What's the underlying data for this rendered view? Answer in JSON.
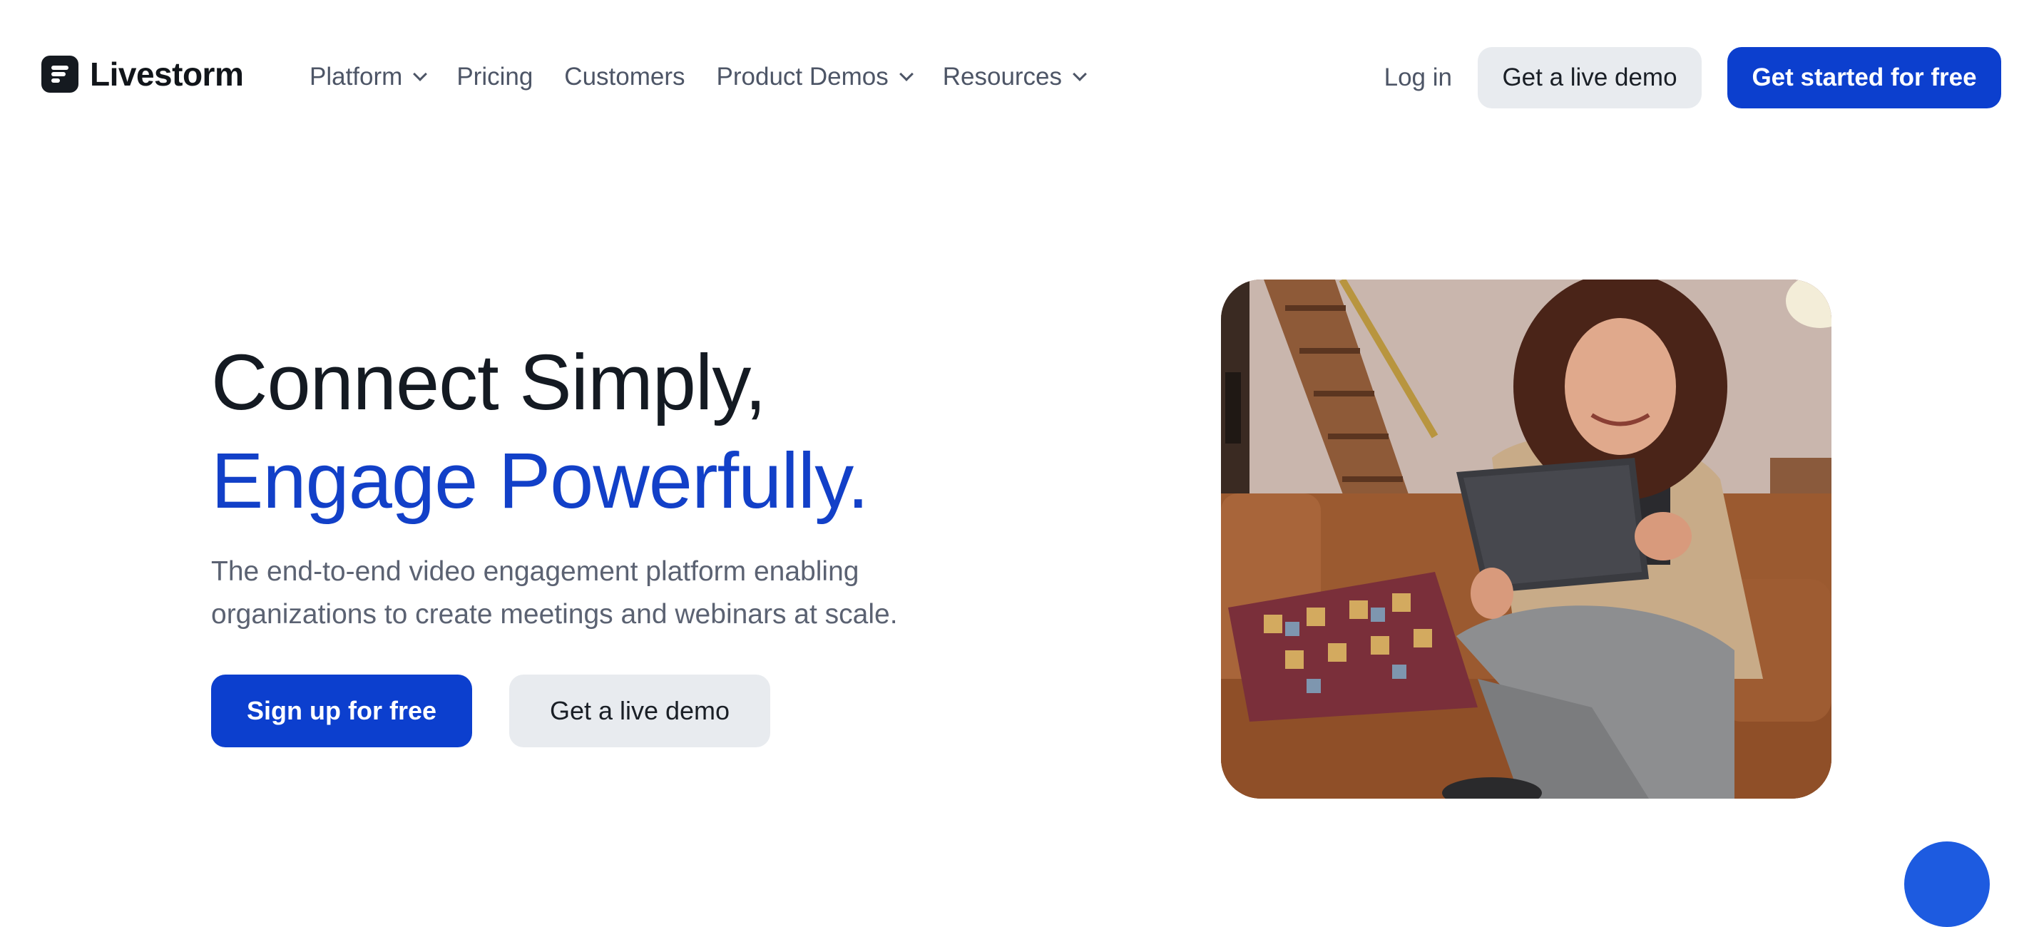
{
  "brand": {
    "name": "Livestorm",
    "primary_color": "#0c3fce",
    "accent_text_color": "#1240c8"
  },
  "nav": {
    "items": [
      {
        "label": "Platform",
        "has_dropdown": true
      },
      {
        "label": "Pricing",
        "has_dropdown": false
      },
      {
        "label": "Customers",
        "has_dropdown": false
      },
      {
        "label": "Product Demos",
        "has_dropdown": true
      },
      {
        "label": "Resources",
        "has_dropdown": true
      }
    ],
    "login_label": "Log in",
    "demo_label": "Get a live demo",
    "start_label": "Get started for free"
  },
  "hero": {
    "title_line1": "Connect Simply,",
    "title_line2": "Engage Powerfully.",
    "subtitle": "The end-to-end video engagement platform enabling organizations to create meetings and webinars at scale.",
    "signup_label": "Sign up for free",
    "demo_label": "Get a live demo",
    "image_icon": "photo-woman-with-tablet-on-sofa"
  },
  "chat": {
    "icon": "chat-bubble-icon"
  }
}
